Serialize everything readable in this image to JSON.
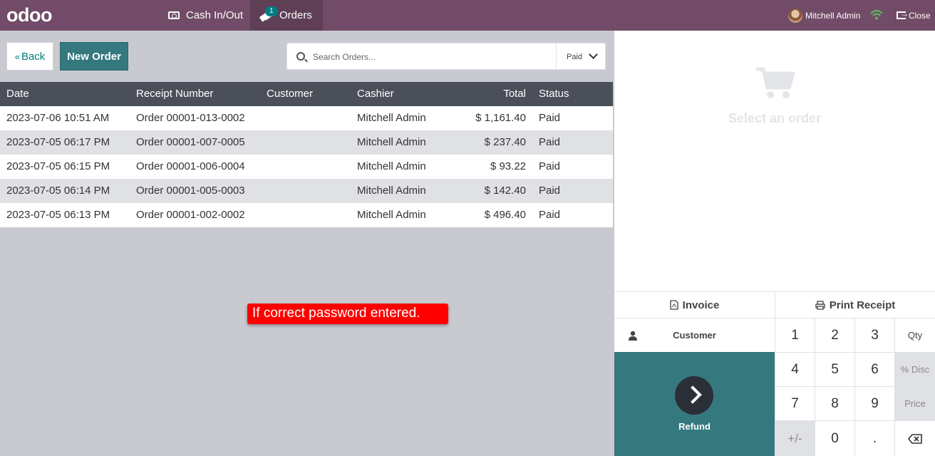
{
  "topbar": {
    "logo": "odoo",
    "cash_label": "Cash In/Out",
    "orders_label": "Orders",
    "orders_badge": "1",
    "user_name": "Mitchell Admin",
    "close_label": "Close"
  },
  "controls": {
    "back_label": "Back",
    "new_order_label": "New Order",
    "search_placeholder": "Search Orders...",
    "filter_value": "Paid"
  },
  "table": {
    "headers": {
      "date": "Date",
      "receipt": "Receipt Number",
      "customer": "Customer",
      "cashier": "Cashier",
      "total": "Total",
      "status": "Status"
    },
    "rows": [
      {
        "date": "2023-07-06 10:51 AM",
        "receipt": "Order 00001-013-0002",
        "customer": "",
        "cashier": "Mitchell Admin",
        "total": "$ 1,161.40",
        "status": "Paid"
      },
      {
        "date": "2023-07-05 06:17 PM",
        "receipt": "Order 00001-007-0005",
        "customer": "",
        "cashier": "Mitchell Admin",
        "total": "$ 237.40",
        "status": "Paid"
      },
      {
        "date": "2023-07-05 06:15 PM",
        "receipt": "Order 00001-006-0004",
        "customer": "",
        "cashier": "Mitchell Admin",
        "total": "$ 93.22",
        "status": "Paid"
      },
      {
        "date": "2023-07-05 06:14 PM",
        "receipt": "Order 00001-005-0003",
        "customer": "",
        "cashier": "Mitchell Admin",
        "total": "$ 142.40",
        "status": "Paid"
      },
      {
        "date": "2023-07-05 06:13 PM",
        "receipt": "Order 00001-002-0002",
        "customer": "",
        "cashier": "Mitchell Admin",
        "total": "$ 496.40",
        "status": "Paid"
      }
    ]
  },
  "tooltip": "If correct password entered.",
  "right_panel": {
    "empty_text": "Select an order",
    "invoice_label": "Invoice",
    "print_label": "Print Receipt",
    "customer_label": "Customer",
    "refund_label": "Refund"
  },
  "numpad": {
    "k1": "1",
    "k2": "2",
    "k3": "3",
    "qty": "Qty",
    "k4": "4",
    "k5": "5",
    "k6": "6",
    "disc": "% Disc",
    "k7": "7",
    "k8": "8",
    "k9": "9",
    "price": "Price",
    "plusminus": "+/-",
    "k0": "0",
    "dot": "."
  },
  "colors": {
    "topbar": "#714b67",
    "primary": "#35797f",
    "alert": "#ff0000"
  }
}
